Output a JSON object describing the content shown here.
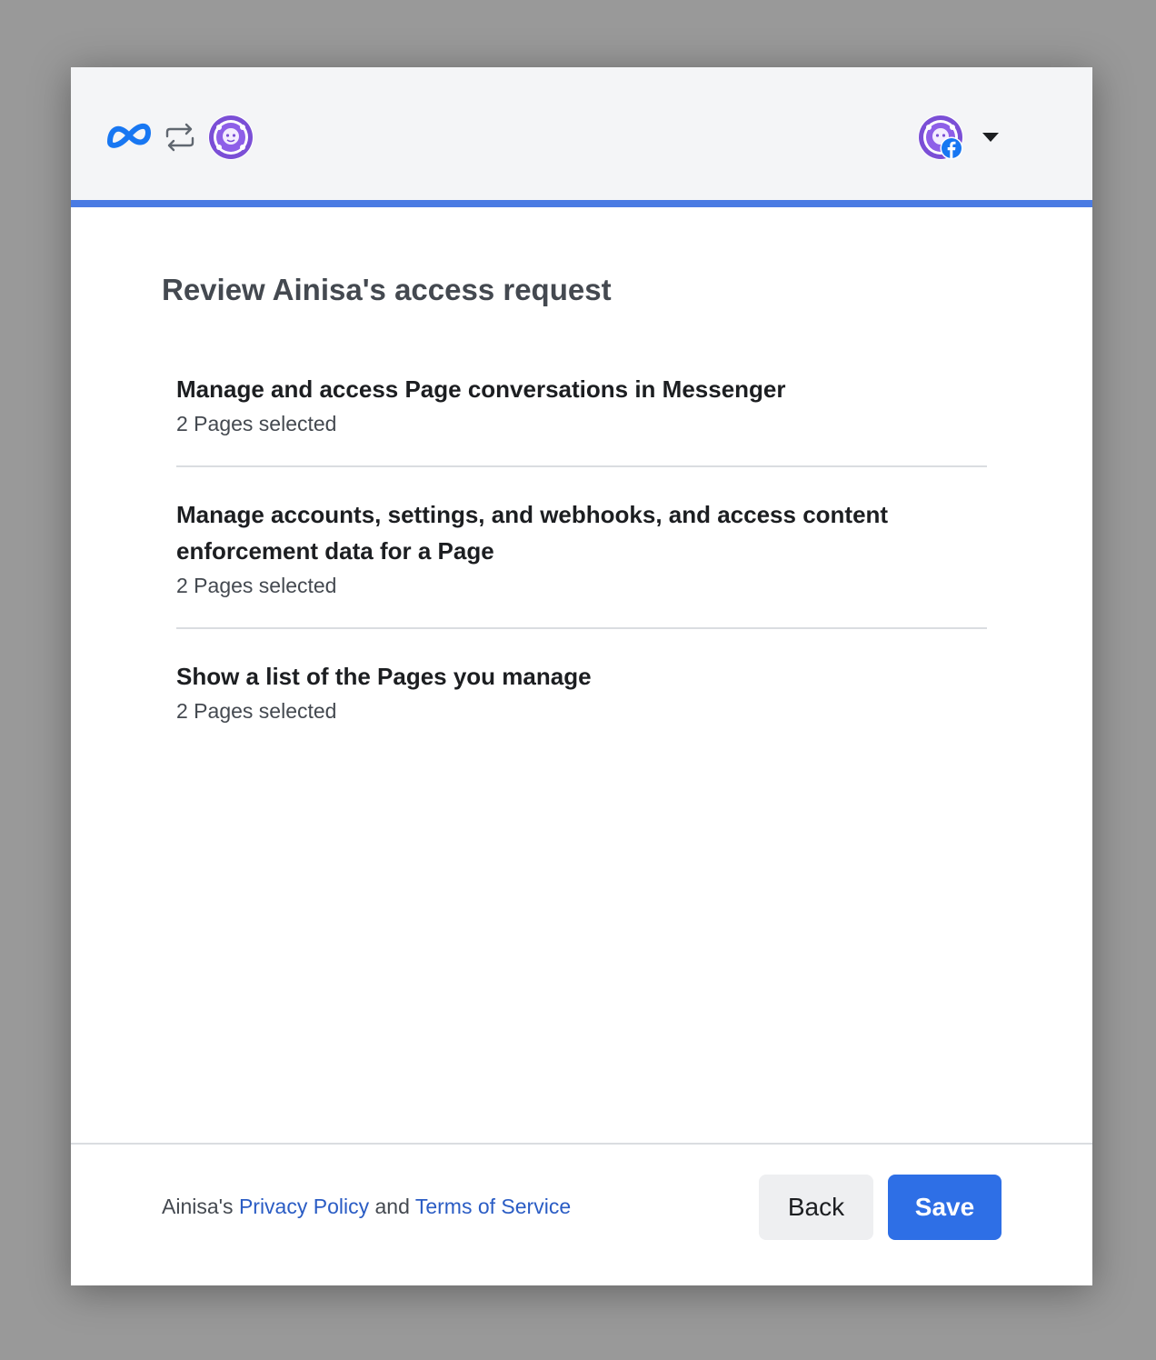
{
  "header": {
    "logo_icon": "meta-logo-icon",
    "connection_icon": "swap-arrows-icon",
    "app_avatar_icon": "app-avatar-icon",
    "account_menu_icon": "chevron-down-icon",
    "accent_color": "#4a7be3"
  },
  "main": {
    "title": "Review Ainisa's access request",
    "permissions": [
      {
        "title": "Manage and access Page conversations in Messenger",
        "detail": "2 Pages selected"
      },
      {
        "title": "Manage accounts, settings, and webhooks, and access content enforcement data for a Page",
        "detail": "2 Pages selected"
      },
      {
        "title": "Show a list of the Pages you manage",
        "detail": "2 Pages selected"
      }
    ]
  },
  "footer": {
    "legal_prefix": "Ainisa's ",
    "privacy_link": "Privacy Policy",
    "legal_and": " and ",
    "terms_link": "Terms of Service",
    "back_label": "Back",
    "save_label": "Save",
    "save_color": "#2e6fe6"
  }
}
